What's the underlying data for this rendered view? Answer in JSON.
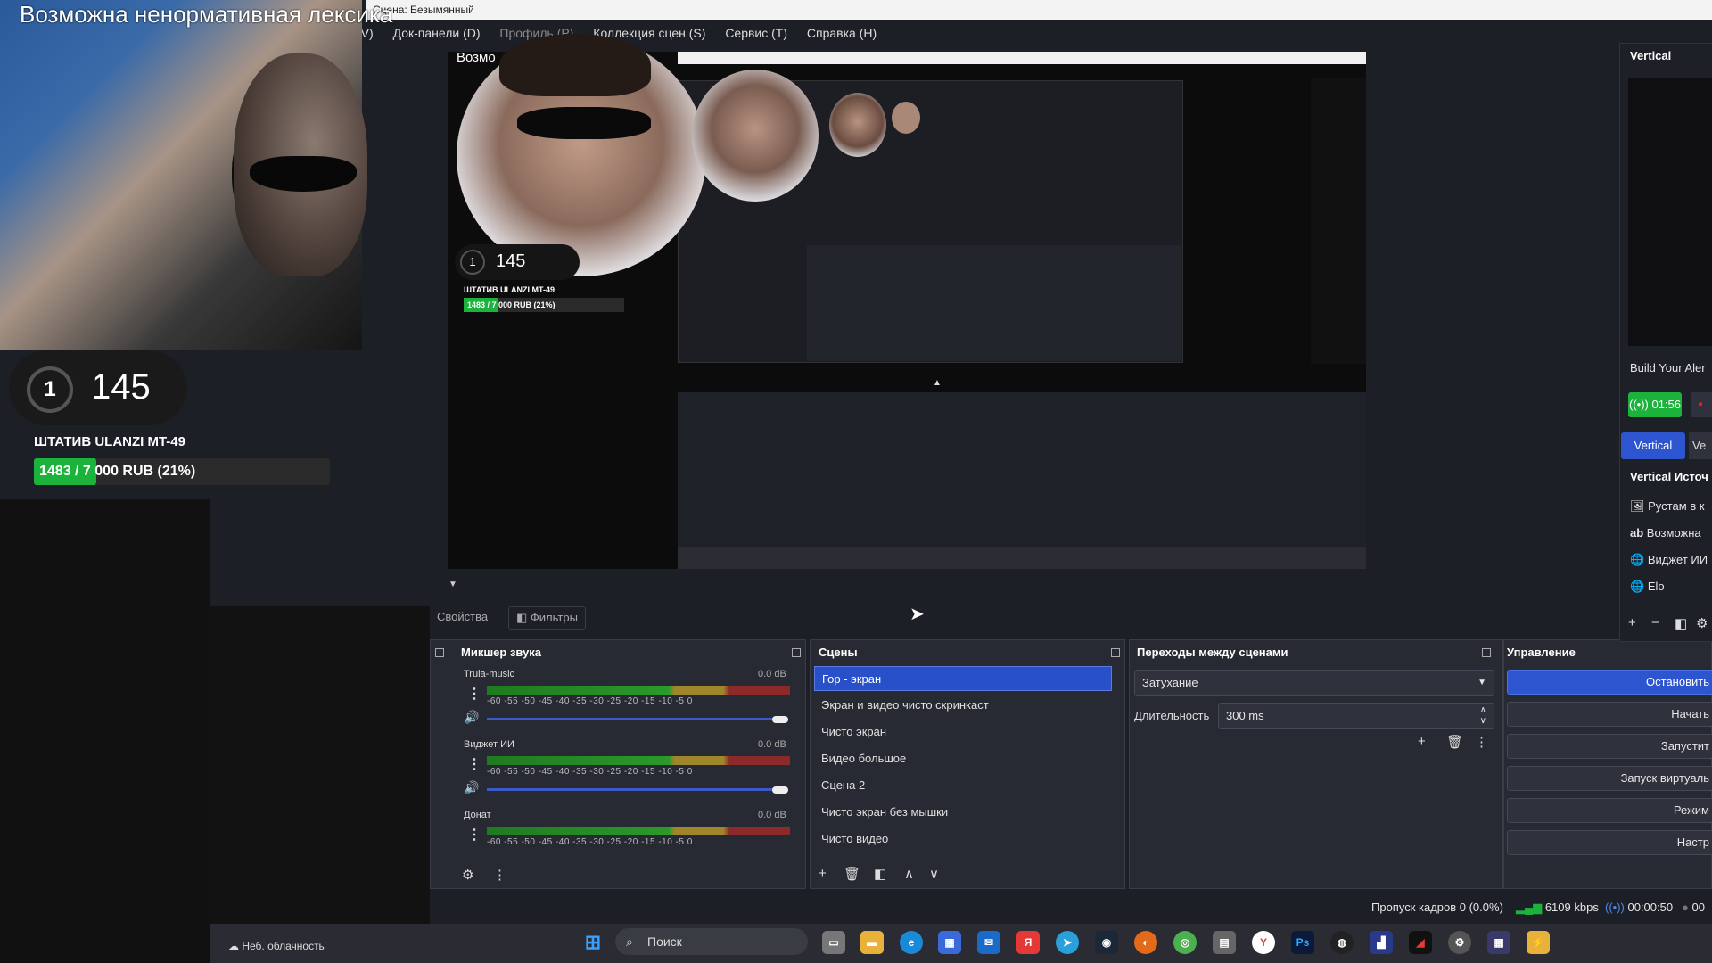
{
  "window": {
    "title": "Сцена: Безымянный"
  },
  "menu": [
    "(V)",
    "Док-панели (D)",
    "Профиль (P)",
    "Коллекция сцен (S)",
    "Сервис (T)",
    "Справка (H)"
  ],
  "overlay": {
    "title": "Возможна ненормативная лексика",
    "subscribers_ring": "1",
    "subscribers_count": "145",
    "goal_title": "ШТАТИВ ULANZI MT-49",
    "goal_text": "1483 / 7 000 RUB (21%)",
    "goal_progress": 0.21
  },
  "tabs": {
    "properties": "Свойства",
    "filters": "Фильтры"
  },
  "mixer": {
    "title": "Микшер звука",
    "scale": "-60  -55  -50  -45  -40  -35  -30  -25  -20  -15  -10   -5    0",
    "channels": [
      {
        "name": "Truia-music",
        "db": "0.0 dB"
      },
      {
        "name": "Виджет ИИ",
        "db": "0.0 dB"
      },
      {
        "name": "Донат",
        "db": "0.0 dB"
      }
    ]
  },
  "scenes": {
    "title": "Сцены",
    "items": [
      "Гор - экран",
      "Экран и видео чисто скринкаст",
      "Чисто экран",
      "Видео большое",
      "Сцена 2",
      "Чисто экран без мышки",
      "Чисто видео"
    ]
  },
  "transitions": {
    "title": "Переходы между сценами",
    "type": "Затухание",
    "duration_label": "Длительность",
    "duration_value": "300 ms"
  },
  "controls": {
    "title": "Управление",
    "buttons": [
      "Остановить",
      "Начать",
      "Запустит",
      "Запуск виртуаль",
      "Режим",
      "Настр"
    ]
  },
  "vertical": {
    "title": "Vertical",
    "alert_text": "Build Your Aler",
    "timer": "01:56",
    "tab": "Vertical",
    "tab2": "Ve",
    "sources_title": "Vertical Источ",
    "sources": [
      "Рустам в к",
      "Возможна",
      "Виджет ИИ",
      "Elo"
    ]
  },
  "status": {
    "dropped": "Пропуск кадров 0 (0.0%)",
    "bitrate": "6109 kbps",
    "time": "00:00:50",
    "time2": "00"
  },
  "taskbar": {
    "weather": "Неб. облачность",
    "search": "Поиск"
  },
  "preview": {
    "subtitle": "Возмо",
    "sub_count": "145",
    "sub_ring": "1",
    "goal_title": "ШТАТИВ ULANZI MT-49",
    "goal_text": "1483 / 7 000 RUB (21%)"
  },
  "colors": {
    "accent": "#2d55d0",
    "green": "#1bb33b",
    "bg": "#1d1f26",
    "panel": "#272a33"
  }
}
